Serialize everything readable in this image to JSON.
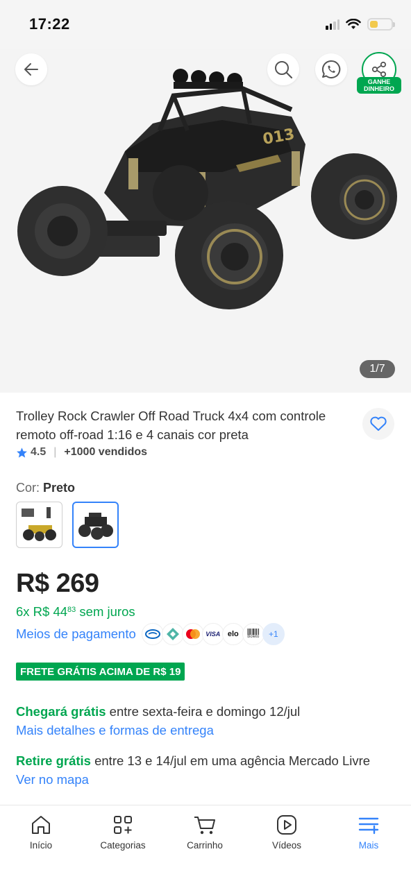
{
  "status_bar": {
    "time": "17:22"
  },
  "gallery": {
    "counter": "1/7",
    "share_badge": "GANHE DINHEIRO"
  },
  "product": {
    "title": "Trolley Rock Crawler Off Road Truck 4x4 com controle remoto off-road 1:16 e 4 canais cor preta",
    "rating": "4.5",
    "sold": "+1000 vendidos"
  },
  "color": {
    "label": "Cor: ",
    "value": "Preto"
  },
  "price": {
    "main": "R$ 269",
    "installments_prefix": "6x R$ 44",
    "installments_cents": "83",
    "installments_suffix": " sem juros"
  },
  "payment": {
    "link": "Meios de pagamento",
    "more": "+1",
    "visa": "VISA",
    "elo": "elo",
    "boleto": "Boleto"
  },
  "shipping_badge": "FRETE GRÁTIS ACIMA DE R$ 19",
  "delivery": {
    "highlight": "Chegará grátis",
    "text": " entre sexta-feira e domingo 12/jul",
    "link": "Mais detalhes e formas de entrega"
  },
  "pickup": {
    "highlight": "Retire grátis",
    "text": " entre 13 e 14/jul em uma agência Mercado Livre",
    "link": "Ver no mapa"
  },
  "nav": [
    {
      "label": "Início",
      "icon": "home-icon"
    },
    {
      "label": "Categorias",
      "icon": "grid-plus-icon"
    },
    {
      "label": "Carrinho",
      "icon": "cart-icon"
    },
    {
      "label": "Vídeos",
      "icon": "play-icon"
    },
    {
      "label": "Mais",
      "icon": "menu-plus-icon"
    }
  ],
  "colors": {
    "accent": "#3483fa",
    "green": "#00a650",
    "gallery_bg": "#f4f4f4"
  }
}
